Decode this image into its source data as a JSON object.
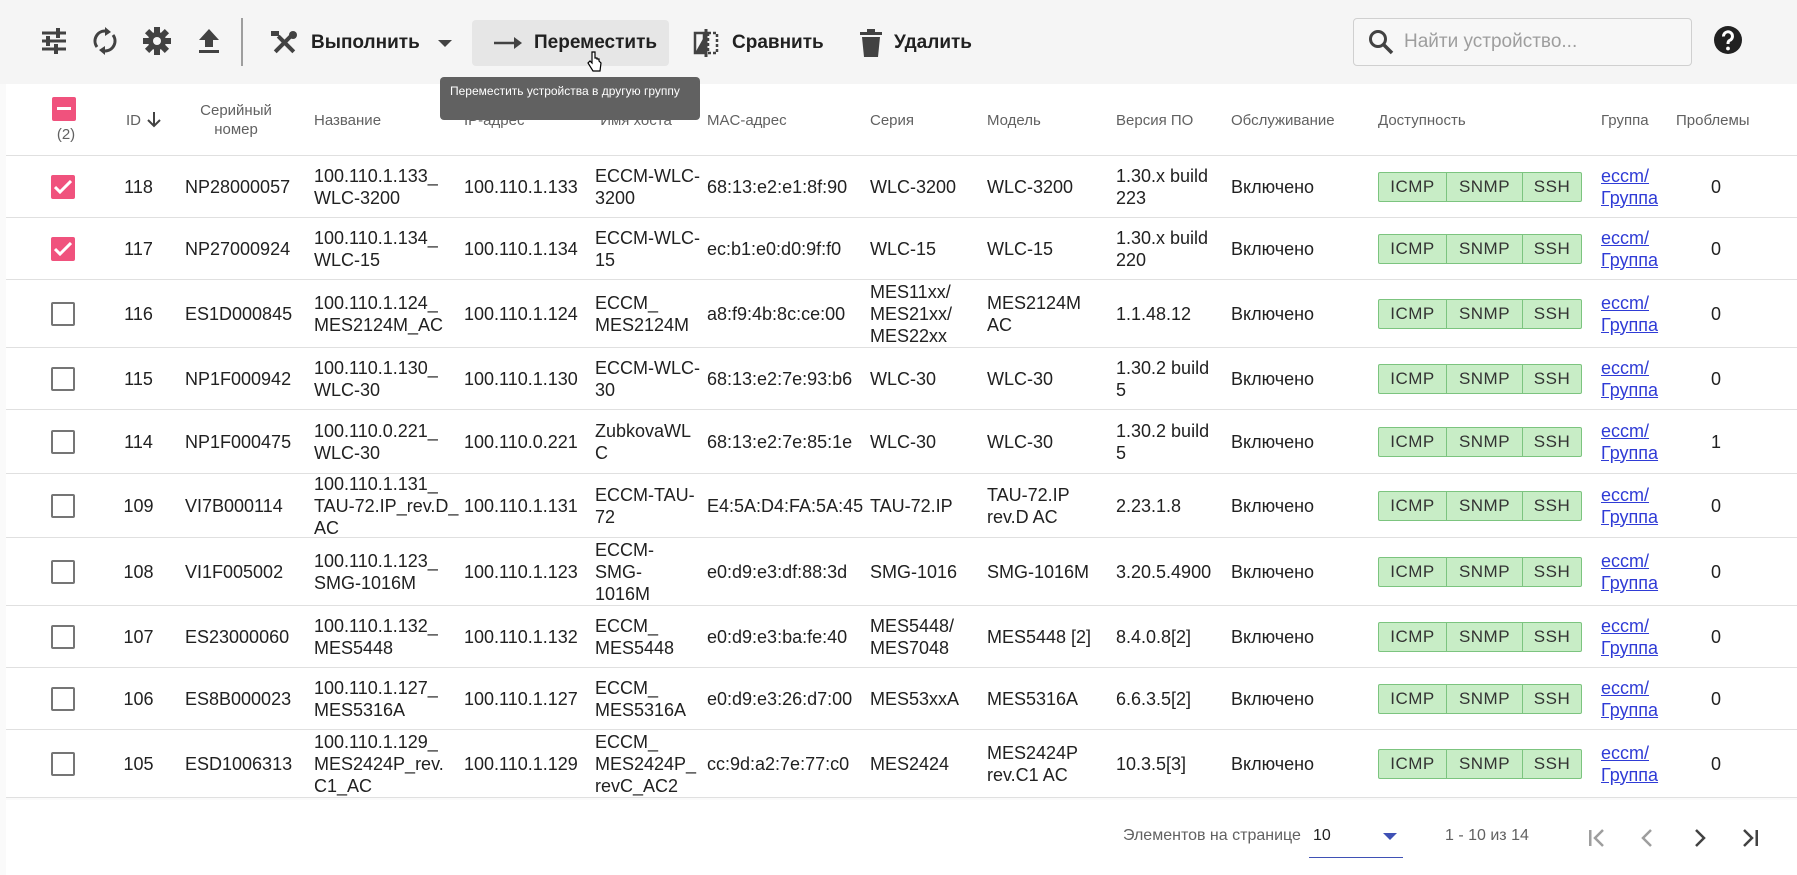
{
  "toolbar": {
    "execute_label": "Выполнить",
    "move_label": "Переместить",
    "compare_label": "Сравнить",
    "delete_label": "Удалить",
    "search_placeholder": "Найти устройство..."
  },
  "tooltip": "Переместить устройства в другую группу",
  "table": {
    "selected_count": "(2)",
    "headers": {
      "id": "ID",
      "serial": "Серийный номер",
      "name": "Название",
      "ip": "IP-адрес",
      "hostname": "Имя хоста",
      "mac": "MAC-адрес",
      "series": "Серия",
      "model": "Модель",
      "firmware": "Версия ПО",
      "service": "Обслуживание",
      "availability": "Доступность",
      "group": "Группа",
      "problems": "Проблемы"
    },
    "availability_labels": [
      "ICMP",
      "SNMP",
      "SSH"
    ],
    "rows": [
      {
        "checked": true,
        "id": "118",
        "serial": "NP28000057",
        "name": "100.110.1.133_\nWLC-3200",
        "ip": "100.110.1.133",
        "hostname": "ECCM-WLC-\n3200",
        "mac": "68:13:e2:e1:8f:90",
        "series": "WLC-3200",
        "model": "WLC-3200",
        "firmware": "1.30.x build\n223",
        "service": "Включено",
        "group": "eccm/\nГруппа",
        "problems": "0"
      },
      {
        "checked": true,
        "id": "117",
        "serial": "NP27000924",
        "name": "100.110.1.134_\nWLC-15",
        "ip": "100.110.1.134",
        "hostname": "ECCM-WLC-\n15",
        "mac": "ec:b1:e0:d0:9f:f0",
        "series": "WLC-15",
        "model": "WLC-15",
        "firmware": "1.30.x build\n220",
        "service": "Включено",
        "group": "eccm/\nГруппа",
        "problems": "0"
      },
      {
        "checked": false,
        "id": "116",
        "serial": "ES1D000845",
        "name": "100.110.1.124_\nMES2124M_AC",
        "ip": "100.110.1.124",
        "hostname": "ECCM_\nMES2124M",
        "mac": "a8:f9:4b:8c:ce:00",
        "series": "MES11xx/\nMES21xx/\nMES22xx",
        "model": "MES2124M\nAC",
        "firmware": "1.1.48.12",
        "service": "Включено",
        "group": "eccm/\nГруппа",
        "problems": "0"
      },
      {
        "checked": false,
        "id": "115",
        "serial": "NP1F000942",
        "name": "100.110.1.130_\nWLC-30",
        "ip": "100.110.1.130",
        "hostname": "ECCM-WLC-\n30",
        "mac": "68:13:e2:7e:93:b6",
        "series": "WLC-30",
        "model": "WLC-30",
        "firmware": "1.30.2 build\n5",
        "service": "Включено",
        "group": "eccm/\nГруппа",
        "problems": "0"
      },
      {
        "checked": false,
        "id": "114",
        "serial": "NP1F000475",
        "name": "100.110.0.221_\nWLC-30",
        "ip": "100.110.0.221",
        "hostname": "ZubkovaWL\nC",
        "mac": "68:13:e2:7e:85:1e",
        "series": "WLC-30",
        "model": "WLC-30",
        "firmware": "1.30.2 build\n5",
        "service": "Включено",
        "group": "eccm/\nГруппа",
        "problems": "1"
      },
      {
        "checked": false,
        "id": "109",
        "serial": "VI7B000114",
        "name": "100.110.1.131_\nTAU-72.IP_rev.D_\nAC",
        "ip": "100.110.1.131",
        "hostname": "ECCM-TAU-\n72",
        "mac": "E4:5A:D4:FA:5A:45",
        "series": "TAU-72.IP",
        "model": "TAU-72.IP\nrev.D AC",
        "firmware": "2.23.1.8",
        "service": "Включено",
        "group": "eccm/\nГруппа",
        "problems": "0"
      },
      {
        "checked": false,
        "id": "108",
        "serial": "VI1F005002",
        "name": "100.110.1.123_\nSMG-1016M",
        "ip": "100.110.1.123",
        "hostname": "ECCM-\nSMG-\n1016M",
        "mac": "e0:d9:e3:df:88:3d",
        "series": "SMG-1016",
        "model": "SMG-1016M",
        "firmware": "3.20.5.4900",
        "service": "Включено",
        "group": "eccm/\nГруппа",
        "problems": "0"
      },
      {
        "checked": false,
        "id": "107",
        "serial": "ES23000060",
        "name": "100.110.1.132_\nMES5448",
        "ip": "100.110.1.132",
        "hostname": "ECCM_\nMES5448",
        "mac": "e0:d9:e3:ba:fe:40",
        "series": "MES5448/\nMES7048",
        "model": "MES5448 [2]",
        "firmware": "8.4.0.8[2]",
        "service": "Включено",
        "group": "eccm/\nГруппа",
        "problems": "0"
      },
      {
        "checked": false,
        "id": "106",
        "serial": "ES8B000023",
        "name": "100.110.1.127_\nMES5316A",
        "ip": "100.110.1.127",
        "hostname": "ECCM_\nMES5316A",
        "mac": "e0:d9:e3:26:d7:00",
        "series": "MES53xxA",
        "model": "MES5316A",
        "firmware": "6.6.3.5[2]",
        "service": "Включено",
        "group": "eccm/\nГруппа",
        "problems": "0"
      },
      {
        "checked": false,
        "id": "105",
        "serial": "ESD1006313",
        "name": "100.110.1.129_\nMES2424P_rev.\nC1_AC",
        "ip": "100.110.1.129",
        "hostname": "ECCM_\nMES2424P_\nrevC_AC2",
        "mac": "cc:9d:a2:7e:77:c0",
        "series": "MES2424",
        "model": "MES2424P\nrev.C1 AC",
        "firmware": "10.3.5[3]",
        "service": "Включено",
        "group": "eccm/\nГруппа",
        "problems": "0"
      }
    ]
  },
  "paginator": {
    "items_per_page_label": "Элементов на странице",
    "items_per_page_value": "10",
    "range_label": "1 - 10 из 14"
  },
  "colors": {
    "accent_pink": "#f0527d",
    "availability_green": "#c8edc6",
    "link_blue": "#2f3bd6"
  }
}
